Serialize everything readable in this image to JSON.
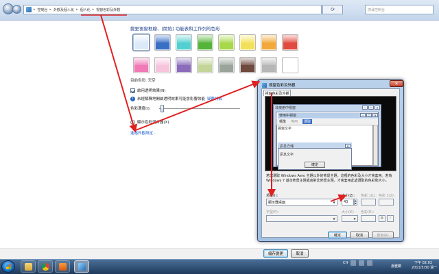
{
  "address": {
    "crumbs": [
      "控制台",
      "外觀及個人化",
      "個人化",
      "視窗色彩及外觀"
    ],
    "search_placeholder": "搜尋控制台"
  },
  "main": {
    "heading": "變更視窗框線、[開始] 功能表和工作列的色彩",
    "swatches_row1": [
      "#dbe9f9",
      "#3a6fc6",
      "#52cfd0",
      "#55b53a",
      "#a7d84a",
      "#f3e05a",
      "#f2a83a",
      "#e14b3f"
    ],
    "swatches_row2": [
      "#f07ab6",
      "#f6c5dc",
      "#8c6bbb",
      "#c4d59a",
      "#9aa49a",
      "#6e4a3f",
      "#b7b7b7",
      "#ffffff"
    ],
    "current_color": "目前色彩: 天空",
    "enable_transparency": "啟用透明效果(N)",
    "transparency_info": "未經解釋地開啟透明效果可能會影響效能",
    "info_link": "疑難排解",
    "intensity_label": "色彩濃度(I):",
    "mixer_label": "顯示色彩混合器(X)",
    "advanced_link": "進階外觀設定..."
  },
  "bottom": {
    "save": "儲存變更",
    "cancel": "取消"
  },
  "dialog": {
    "title": "視窗色彩及外觀",
    "tab": "視窗色彩及外觀",
    "preview": {
      "inactive_title": "非使用中視窗",
      "active_title": "使用中視窗",
      "menu_items": [
        "標準",
        "停用",
        "選取"
      ],
      "window_text": "視窗文字",
      "msg_title": "訊息方塊",
      "msg_text": "訊息文字",
      "ok": "確定"
    },
    "description": "若您選取 Windows Aero 主題以外的佈景主題，這裡的色彩及大小才會套用。若為 Windows 7 基本佈景主題或高對比佈景主題，才會套用此處選取的色彩和大小。",
    "item_label": "項目(I):",
    "item_value": "顯示器桌面",
    "size_label": "大小(Z):",
    "size_value": "43",
    "color1_label": "色彩 1(L):",
    "color2_label": "色彩 2(2):",
    "font_label": "字型(F):",
    "font_size_label": "大小(E):",
    "font_color_label": "色彩(R):",
    "bold": "B",
    "italic": "I",
    "ok": "確定",
    "cancel": "取消",
    "apply": "套用(A)"
  },
  "taskbar": {
    "tray_text": "CH",
    "lang": "嘉雅霸",
    "time": "下午 02:02",
    "date": "2011/5/30 週一"
  }
}
